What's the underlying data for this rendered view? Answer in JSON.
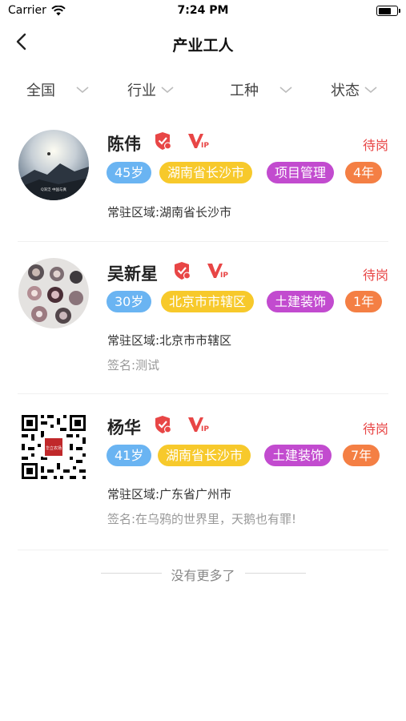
{
  "status_bar": {
    "carrier": "Carrier",
    "time": "7:24 PM",
    "battery_level": 0.75
  },
  "nav": {
    "title": "产业工人"
  },
  "filters": [
    {
      "label": "全国"
    },
    {
      "label": "行业"
    },
    {
      "label": "工种"
    },
    {
      "label": "状态"
    }
  ],
  "workers": [
    {
      "name": "陈伟",
      "status": "待岗",
      "age": "45岁",
      "location": "湖南省长沙市",
      "job": "项目管理",
      "years": "4年",
      "region": "常驻区域:湖南省长沙市",
      "signature": "",
      "avatar_caption": "Q深泛 中国与真"
    },
    {
      "name": "吴新星",
      "status": "待岗",
      "age": "30岁",
      "location": "北京市市辖区",
      "job": "土建装饰",
      "years": "1年",
      "region": "常驻区域:北京市市辖区",
      "signature": "签名:测试"
    },
    {
      "name": "杨华",
      "status": "待岗",
      "age": "41岁",
      "location": "湖南省长沙市",
      "job": "土建装饰",
      "years": "7年",
      "region": "常驻区域:广东省广州市",
      "signature": "签名:在乌鸦的世界里，天鹅也有罪!",
      "avatar_seal_text": "华立农场"
    }
  ],
  "footer": {
    "end_text": "没有更多了"
  },
  "colors": {
    "accent_red": "#e84646",
    "tag_age": "#6ab4f2",
    "tag_location": "#f7c92b",
    "tag_job": "#c24bcf",
    "tag_years": "#f47f44"
  },
  "icons": {
    "shield": "verified-shield-icon",
    "vip": "vip-icon",
    "back": "chevron-left-icon",
    "filter_arrow": "chevron-down-icon"
  }
}
